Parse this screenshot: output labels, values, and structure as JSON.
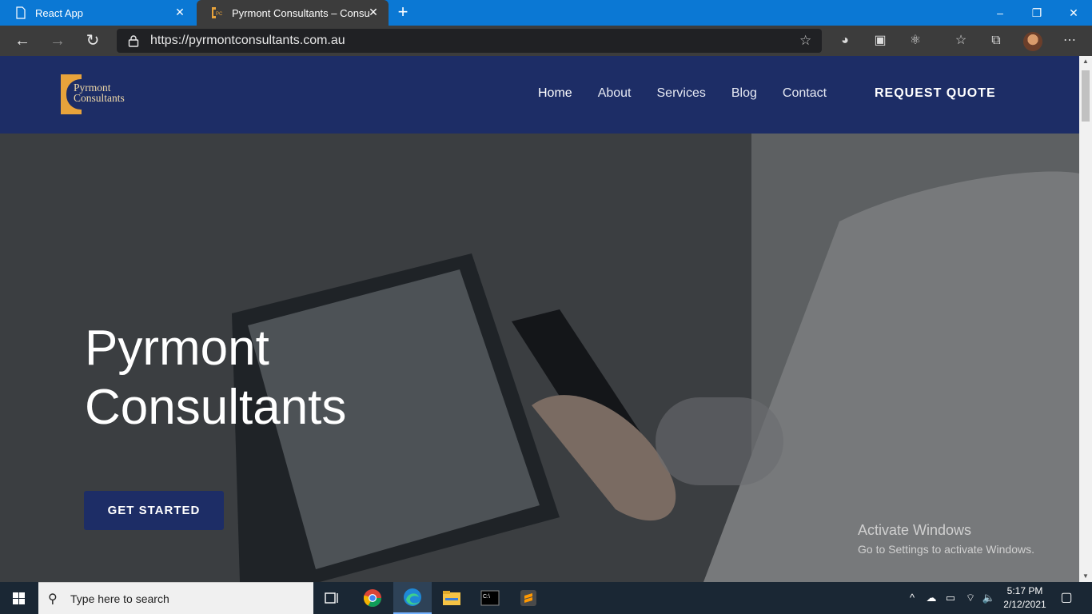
{
  "browser": {
    "tabs": [
      {
        "title": "React App"
      },
      {
        "title": "Pyrmont Consultants – Consultancy"
      }
    ],
    "url": "https://pyrmontconsultants.com.au",
    "window_controls": {
      "minimize": "–",
      "restore": "❐",
      "close": "✕"
    }
  },
  "site": {
    "logo": {
      "line1": "Pyrmont",
      "line2": "Consultants"
    },
    "nav": [
      "Home",
      "About",
      "Services",
      "Blog",
      "Contact"
    ],
    "active_nav": "Home",
    "quote_button": "REQUEST QUOTE",
    "hero": {
      "title_line1": "Pyrmont",
      "title_line2": "Consultants",
      "cta": "GET STARTED"
    }
  },
  "watermark": {
    "line1": "Activate Windows",
    "line2": "Go to Settings to activate Windows."
  },
  "taskbar": {
    "search_placeholder": "Type here to search",
    "time": "5:17 PM",
    "date": "2/12/2021",
    "apps": [
      "task-view",
      "chrome",
      "edge",
      "file-explorer",
      "terminal",
      "sublime-text"
    ]
  },
  "colors": {
    "navy": "#1d2d66",
    "logo_gold": "#e8a33b",
    "tab_strip": "#0b78d4"
  }
}
